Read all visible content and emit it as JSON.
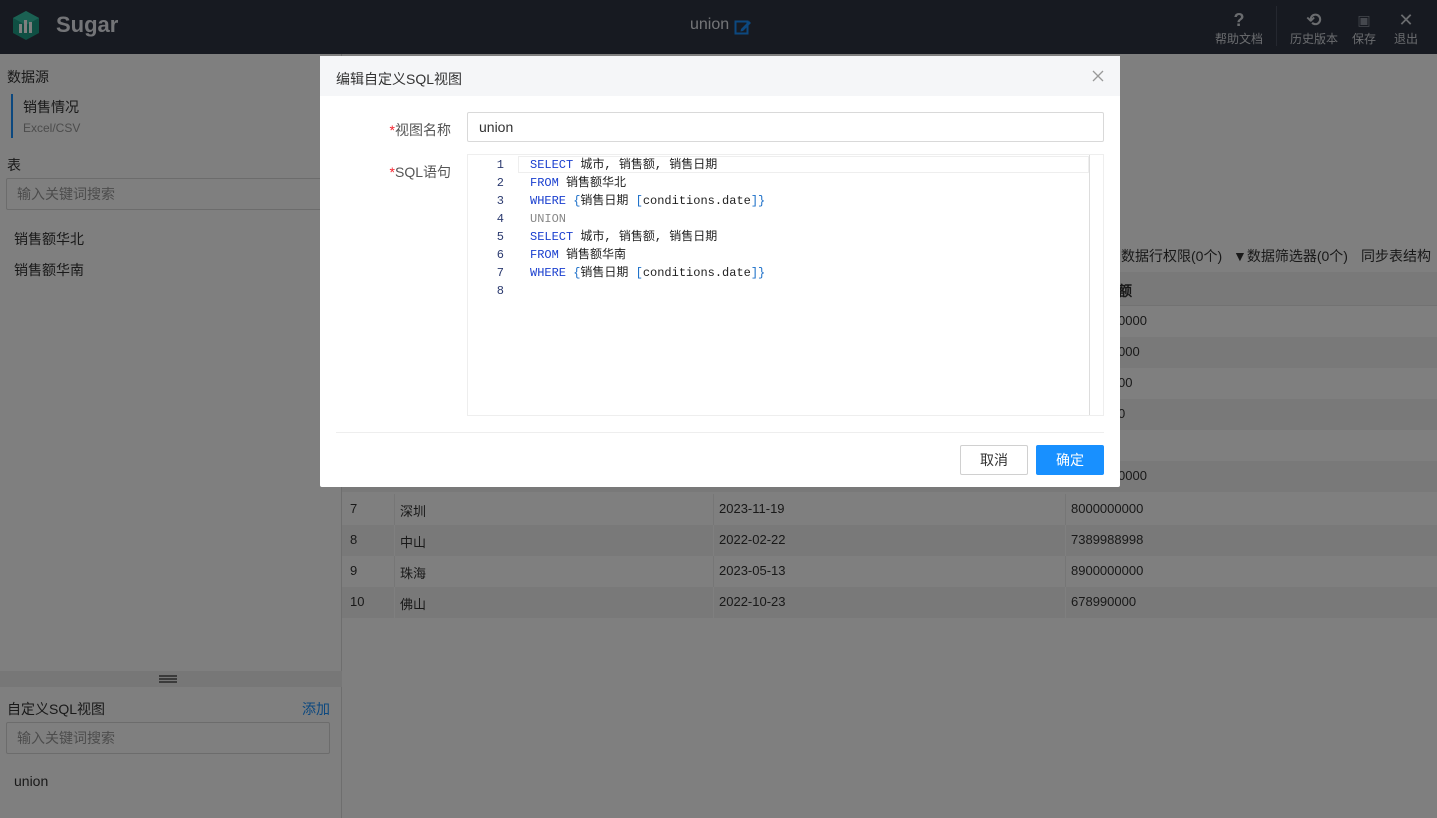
{
  "topbar": {
    "app_name": "Sugar",
    "doc_title": "union",
    "tools": [
      {
        "label": "帮助文档",
        "icon": "help-icon",
        "glyph": "?"
      },
      {
        "label": "历史版本",
        "icon": "history-icon",
        "glyph": "⟲"
      },
      {
        "label": "保存",
        "icon": "save-icon",
        "glyph": "▣"
      },
      {
        "label": "退出",
        "icon": "close-icon",
        "glyph": "✕"
      }
    ]
  },
  "left": {
    "datasource_title": "数据源",
    "datasource": {
      "name": "销售情况",
      "type": "Excel/CSV"
    },
    "tables_title": "表",
    "table_search_placeholder": "输入关键词搜索",
    "tables": [
      "销售额华北",
      "销售额华南"
    ],
    "sql_views_title": "自定义SQL视图",
    "add_label": "添加",
    "sql_search_placeholder": "输入关键词搜索",
    "sql_views": [
      "union"
    ]
  },
  "right": {
    "toolbar": {
      "row_permission": "数据行权限(0个)",
      "filter": "数据筛选器(0个)",
      "sync": "同步表结构"
    },
    "grid": {
      "header_partial": "额",
      "visible_partial_values": [
        "0000",
        "000",
        "00",
        "0",
        "",
        "0000"
      ],
      "rows": [
        {
          "n": "7",
          "city": "深圳",
          "date": "2023-11-19",
          "amount": "8000000000"
        },
        {
          "n": "8",
          "city": "中山",
          "date": "2022-02-22",
          "amount": "7389988998"
        },
        {
          "n": "9",
          "city": "珠海",
          "date": "2023-05-13",
          "amount": "8900000000"
        },
        {
          "n": "10",
          "city": "佛山",
          "date": "2022-10-23",
          "amount": "678990000"
        }
      ]
    }
  },
  "modal": {
    "title": "编辑自定义SQL视图",
    "name_label": "视图名称",
    "name_value": "union",
    "sql_label": "SQL语句",
    "required_mark": "*",
    "cancel_label": "取消",
    "ok_label": "确定",
    "code": [
      {
        "n": "1",
        "parts": [
          [
            "kw",
            "SELECT"
          ],
          [
            "",
            " 城市, 销售额, 销售日期"
          ]
        ]
      },
      {
        "n": "2",
        "parts": [
          [
            "kw",
            "FROM"
          ],
          [
            "",
            " 销售额华北"
          ]
        ]
      },
      {
        "n": "3",
        "parts": [
          [
            "kw",
            "WHERE"
          ],
          [
            "",
            " "
          ],
          [
            "br",
            "{"
          ],
          [
            "",
            "销售日期 "
          ],
          [
            "br",
            "["
          ],
          [
            "",
            "conditions.date"
          ],
          [
            "br",
            "]}"
          ]
        ]
      },
      {
        "n": "4",
        "parts": [
          [
            "kw-dim",
            "UNION"
          ]
        ]
      },
      {
        "n": "5",
        "parts": [
          [
            "kw",
            "SELECT"
          ],
          [
            "",
            " 城市, 销售额, 销售日期"
          ]
        ]
      },
      {
        "n": "6",
        "parts": [
          [
            "kw",
            "FROM"
          ],
          [
            "",
            " 销售额华南"
          ]
        ]
      },
      {
        "n": "7",
        "parts": [
          [
            "kw",
            "WHERE"
          ],
          [
            "",
            " "
          ],
          [
            "br",
            "{"
          ],
          [
            "",
            "销售日期 "
          ],
          [
            "br",
            "["
          ],
          [
            "",
            "conditions.date"
          ],
          [
            "br",
            "]}"
          ]
        ]
      },
      {
        "n": "8",
        "parts": []
      }
    ]
  },
  "colors": {
    "topbar": "#2f3542",
    "accent": "#1890ff",
    "required": "#f5222d",
    "keyword": "#1a3fcf"
  }
}
